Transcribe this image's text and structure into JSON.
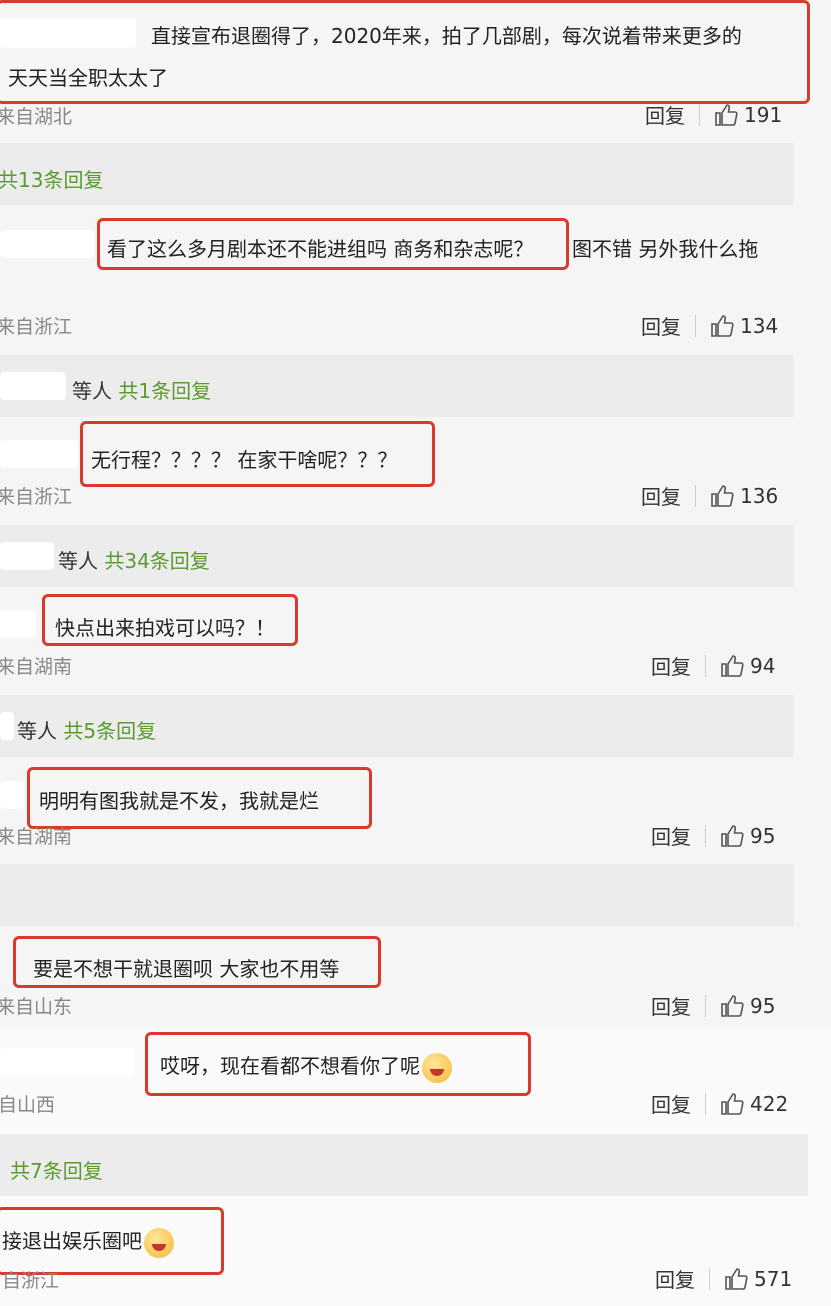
{
  "comments": [
    {
      "text": "直接宣布退圈得了，2020年来，拍了几部剧，每次说着带来更多的",
      "text2": "天天当全职太太了",
      "location": "来自湖北",
      "reply_label": "回复",
      "likes": "191",
      "thread": "共13条回复"
    },
    {
      "text": "看了这么多月剧本还不能进组吗 商务和杂志呢？",
      "text_after": "图不错 另外我什么拖",
      "location": "来自浙江",
      "reply_label": "回复",
      "likes": "134",
      "thread_prefix": "等人",
      "thread": "共1条回复"
    },
    {
      "text": "无行程？？？？ 在家干啥呢？？？",
      "location": "来自浙江",
      "reply_label": "回复",
      "likes": "136",
      "thread_prefix": "等人",
      "thread": "共34条回复"
    },
    {
      "text": "快点出来拍戏可以吗？！",
      "location": "来自湖南",
      "reply_label": "回复",
      "likes": "94",
      "thread_prefix": "等人",
      "thread": "共5条回复"
    },
    {
      "text": "明明有图我就是不发，我就是烂",
      "location": "来自湖南",
      "reply_label": "回复",
      "likes": "95"
    },
    {
      "text": "要是不想干就退圈呗 大家也不用等",
      "location": "来自山东",
      "reply_label": "回复",
      "likes": "95"
    },
    {
      "text": "哎呀，现在看都不想看你了呢",
      "location": "自山西",
      "reply_label": "回复",
      "likes": "422",
      "thread": "共7条回复",
      "emoji": "laughing-crying-face"
    },
    {
      "text": "接退出娱乐圈吧",
      "location": "自浙江",
      "reply_label": "回复",
      "likes": "571",
      "emoji": "laughing-crying-face"
    }
  ],
  "colors": {
    "highlight": "#d93a2b",
    "reply_link": "#5b9a2f",
    "meta": "#888888",
    "band": "#ececec"
  }
}
